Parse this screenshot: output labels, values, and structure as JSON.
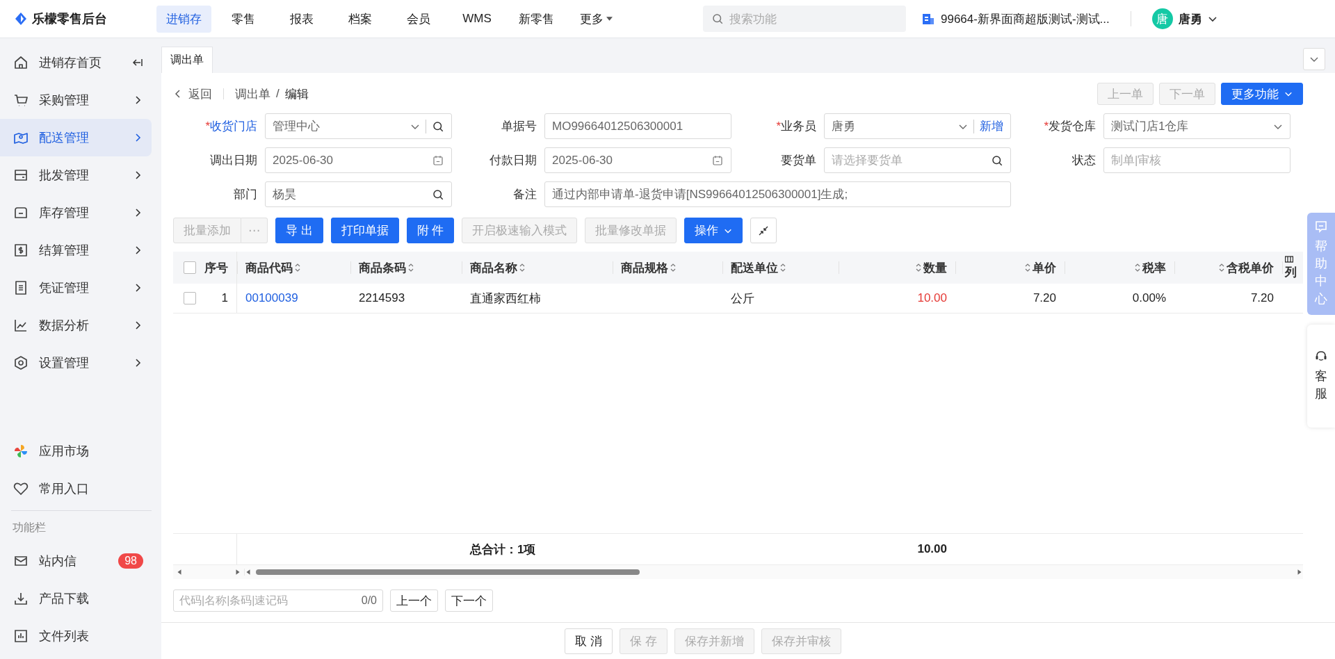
{
  "top_nav": {
    "logo": "乐檬零售后台",
    "menu": [
      {
        "label": "进销存",
        "selected": true
      },
      {
        "label": "零售",
        "selected": false
      },
      {
        "label": "报表",
        "selected": false
      },
      {
        "label": "档案",
        "selected": false
      },
      {
        "label": "会员",
        "selected": false
      },
      {
        "label": "WMS",
        "selected": false
      },
      {
        "label": "新零售",
        "selected": false
      },
      {
        "label": "更多",
        "selected": false,
        "dropdown": true
      }
    ],
    "search": {
      "placeholder": "搜索功能"
    },
    "store": "99664-新界面商超版测试-测试...",
    "user": {
      "avatar": "唐",
      "name": "唐勇"
    }
  },
  "sidebar": {
    "items": [
      {
        "label": "进销存首页",
        "selected": false,
        "kind": "collapse"
      },
      {
        "label": "采购管理",
        "selected": false,
        "kind": "submenu"
      },
      {
        "label": "配送管理",
        "selected": true,
        "kind": "submenu"
      },
      {
        "label": "批发管理",
        "selected": false,
        "kind": "submenu"
      },
      {
        "label": "库存管理",
        "selected": false,
        "kind": "submenu"
      },
      {
        "label": "结算管理",
        "selected": false,
        "kind": "submenu"
      },
      {
        "label": "凭证管理",
        "selected": false,
        "kind": "submenu"
      },
      {
        "label": "数据分析",
        "selected": false,
        "kind": "submenu"
      },
      {
        "label": "设置管理",
        "selected": false,
        "kind": "submenu"
      }
    ],
    "shortcuts": [
      {
        "label": "应用市场"
      },
      {
        "label": "常用入口"
      }
    ],
    "section_title": "功能栏",
    "tools": [
      {
        "label": "站内信",
        "badge": "98"
      },
      {
        "label": "产品下载"
      },
      {
        "label": "文件列表"
      }
    ]
  },
  "tabs": [
    {
      "label": "调出单",
      "selected": true
    }
  ],
  "breadcrumb": {
    "back": "返回",
    "path": [
      "调出单",
      "编辑"
    ],
    "separator": "/"
  },
  "page_buttons": [
    {
      "label": "上一单",
      "kind": "disabled"
    },
    {
      "label": "下一单",
      "kind": "disabled"
    },
    {
      "label": "更多功能",
      "kind": "primary_dropdown"
    }
  ],
  "form": [
    {
      "label": "收货门店",
      "required_mark": "*",
      "link": true,
      "value": "管理中心",
      "kind": "select_search"
    },
    {
      "label": "单据号",
      "link": false,
      "value": "MO99664012506300001",
      "kind": "text"
    },
    {
      "label": "业务员",
      "required_mark": "*",
      "link": false,
      "value": "唐勇",
      "kind": "select_add",
      "action": "新增"
    },
    {
      "label": "发货仓库",
      "required_mark": "*",
      "link": false,
      "value": "测试门店1仓库",
      "kind": "select"
    },
    {
      "label": "调出日期",
      "link": false,
      "value": "2025-06-30",
      "kind": "date"
    },
    {
      "label": "付款日期",
      "link": false,
      "value": "2025-06-30",
      "kind": "date"
    },
    {
      "label": "要货单",
      "link": false,
      "placeholder": "请选择要货单",
      "kind": "search"
    },
    {
      "label": "状态",
      "link": false,
      "placeholder": "制单|审核",
      "kind": "text"
    },
    {
      "label": "部门",
      "link": false,
      "value": "杨昊",
      "kind": "search"
    },
    {
      "label": "备注",
      "link": false,
      "value": "通过内部申请单-退货申请[NS99664012506300001]生成;",
      "kind": "wide"
    }
  ],
  "toolbar": [
    {
      "label": "批量添加",
      "kind": "disabled_more",
      "more": "⋯"
    },
    {
      "label": "导 出",
      "kind": "primary"
    },
    {
      "label": "打印单据",
      "kind": "primary"
    },
    {
      "label": "附 件",
      "kind": "primary"
    },
    {
      "label": "开启极速输入模式",
      "kind": "disabled"
    },
    {
      "label": "批量修改单据",
      "kind": "disabled"
    },
    {
      "label": "操作",
      "kind": "primary_dropdown"
    },
    {
      "kind": "compress"
    }
  ],
  "table": {
    "select_all_checked": false,
    "columns": [
      {
        "label": "序号",
        "kind": "index",
        "sortable": false
      },
      {
        "label": "商品代码",
        "kind": "code",
        "sortable": true
      },
      {
        "label": "商品条码",
        "kind": "text",
        "sortable": true
      },
      {
        "label": "商品名称",
        "kind": "text",
        "sortable": true
      },
      {
        "label": "商品规格",
        "kind": "text",
        "sortable": true
      },
      {
        "label": "配送单位",
        "kind": "text",
        "sortable": true
      },
      {
        "label": "数量",
        "kind": "quantity",
        "sortable": true
      },
      {
        "label": "单价",
        "kind": "number",
        "sortable": true
      },
      {
        "label": "税率",
        "kind": "number",
        "sortable": true
      },
      {
        "label": "含税单价",
        "kind": "number",
        "sortable": true
      },
      {
        "label": "列",
        "kind": "settings",
        "sortable": false
      }
    ],
    "rows": [
      {
        "checked": false,
        "cells": [
          "1",
          "00100039",
          "2214593",
          "直通家西红柿",
          "",
          "公斤",
          "10.00",
          "7.20",
          "0.00%",
          "7.20",
          ""
        ]
      }
    ],
    "footer": {
      "label": "总合计：1项",
      "total_quantity": "10.00"
    }
  },
  "locator": {
    "placeholder": "代码|名称|条码|速记码",
    "count": "0/0",
    "buttons": [
      "上一个",
      "下一个"
    ]
  },
  "bottom_buttons": [
    {
      "label": "取 消",
      "kind": "default"
    },
    {
      "label": "保 存",
      "kind": "disabled"
    },
    {
      "label": "保存并新增",
      "kind": "disabled"
    },
    {
      "label": "保存并审核",
      "kind": "disabled"
    }
  ],
  "float": {
    "help": "帮助中心",
    "service": "客服"
  }
}
